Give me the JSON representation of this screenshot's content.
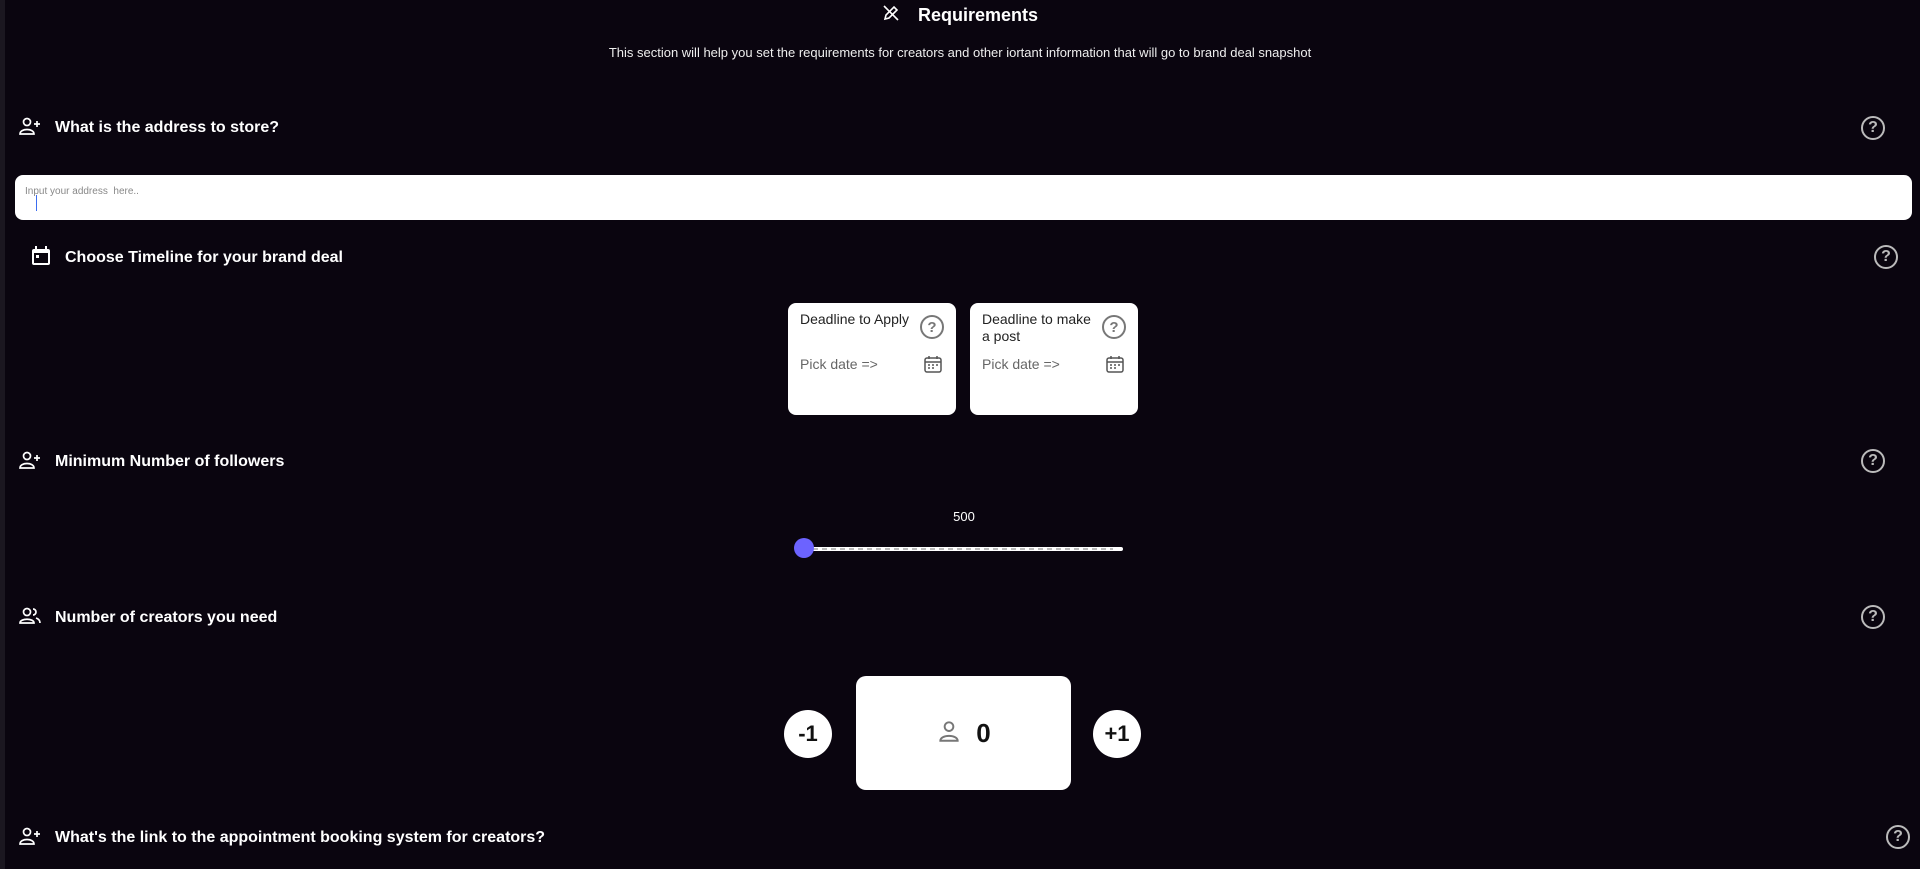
{
  "header": {
    "title": "Requirements",
    "subtitle": "This section will help you set the requirements for creators and other iortant information that will go to brand deal snapshot",
    "icon": "edit-pencil-icon"
  },
  "address": {
    "question": "What is the address to store?",
    "placeholder": "Input your address  here..",
    "value": ""
  },
  "timeline": {
    "question": "Choose Timeline for your brand deal",
    "cards": [
      {
        "title": "Deadline to Apply",
        "pick_label": "Pick date =>"
      },
      {
        "title": "Deadline to make a post",
        "pick_label": "Pick date =>"
      }
    ]
  },
  "followers": {
    "question": "Minimum Number of followers",
    "value": "500",
    "slider_fraction": 0.0
  },
  "creators": {
    "question": "Number of creators you need",
    "decrement_label": "-1",
    "increment_label": "+1",
    "count": "0"
  },
  "booking": {
    "question": "What's the link to the appointment booking system for creators?"
  },
  "help_label": "?",
  "colors": {
    "background": "#0a050f",
    "accent": "#6c63ff",
    "card": "#ffffff"
  }
}
